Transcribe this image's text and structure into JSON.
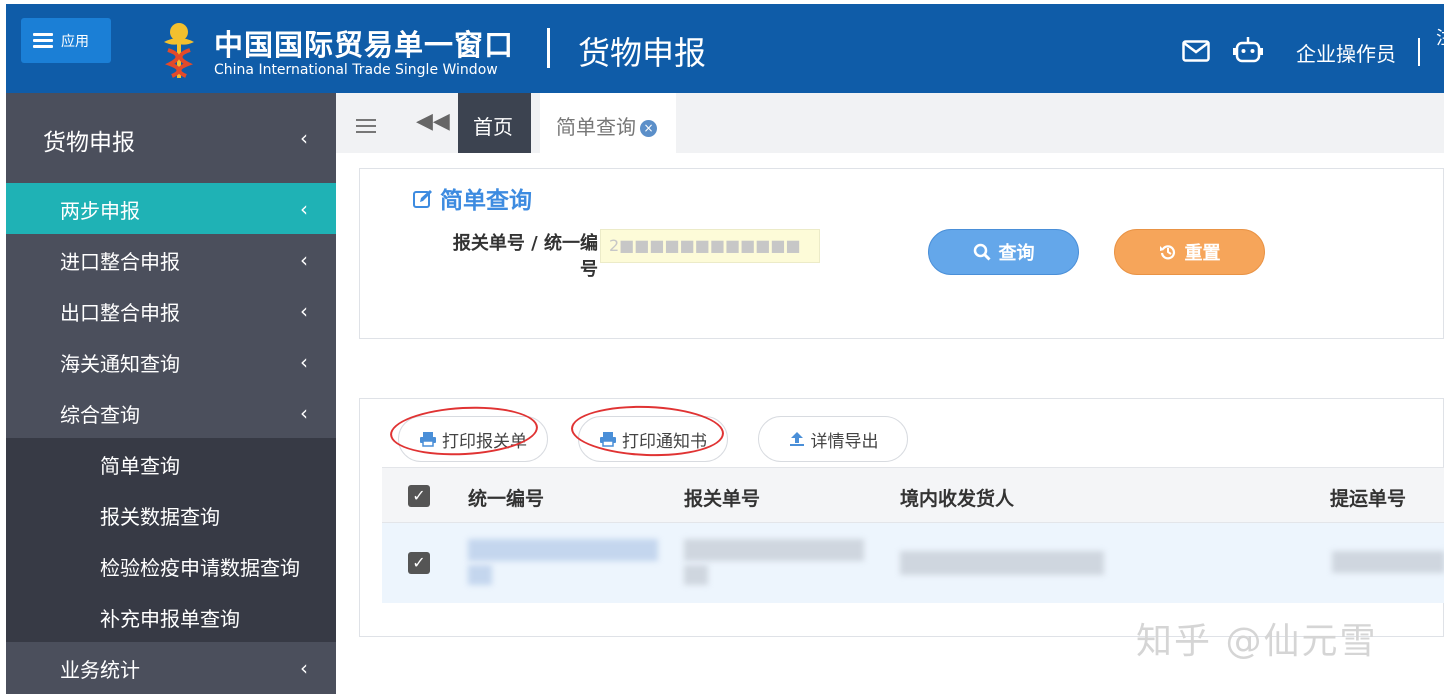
{
  "header": {
    "app_label": "应用",
    "brand_cn": "中国国际贸易单一窗口",
    "brand_en": "China International Trade Single Window",
    "module_title": "货物申报",
    "user": "企业操作员",
    "cut_char": "注"
  },
  "sidebar": {
    "title": "货物申报",
    "items": [
      {
        "label": "两步申报"
      },
      {
        "label": "进口整合申报"
      },
      {
        "label": "出口整合申报"
      },
      {
        "label": "海关通知查询"
      },
      {
        "label": "综合查询"
      },
      {
        "label": "业务统计"
      }
    ],
    "subitems": [
      {
        "label": "简单查询"
      },
      {
        "label": "报关数据查询"
      },
      {
        "label": "检验检疫申请数据查询"
      },
      {
        "label": "补充申报单查询"
      }
    ]
  },
  "tabs": {
    "home": "首页",
    "simple_query": "简单查询",
    "close": "×"
  },
  "query": {
    "title": "简单查询",
    "label": "报关单号 / 统一编号",
    "value_masked": "2■■■■■■■■■■■■",
    "search_label": "查询",
    "reset_label": "重置"
  },
  "toolbar": {
    "print_declaration": "打印报关单",
    "print_notice": "打印通知书",
    "export_details": "详情导出"
  },
  "table": {
    "columns": [
      "统一编号",
      "报关单号",
      "境内收发货人",
      "提运单号"
    ]
  },
  "watermark": "知乎 @仙元雪",
  "colors": {
    "header_bg": "#0f5ca8",
    "sidebar_bg": "#4b4f5c",
    "active_item": "#1fb2b5",
    "query_btn": "#64a7ea",
    "reset_btn": "#f6a55a",
    "annotation": "#e03333"
  }
}
